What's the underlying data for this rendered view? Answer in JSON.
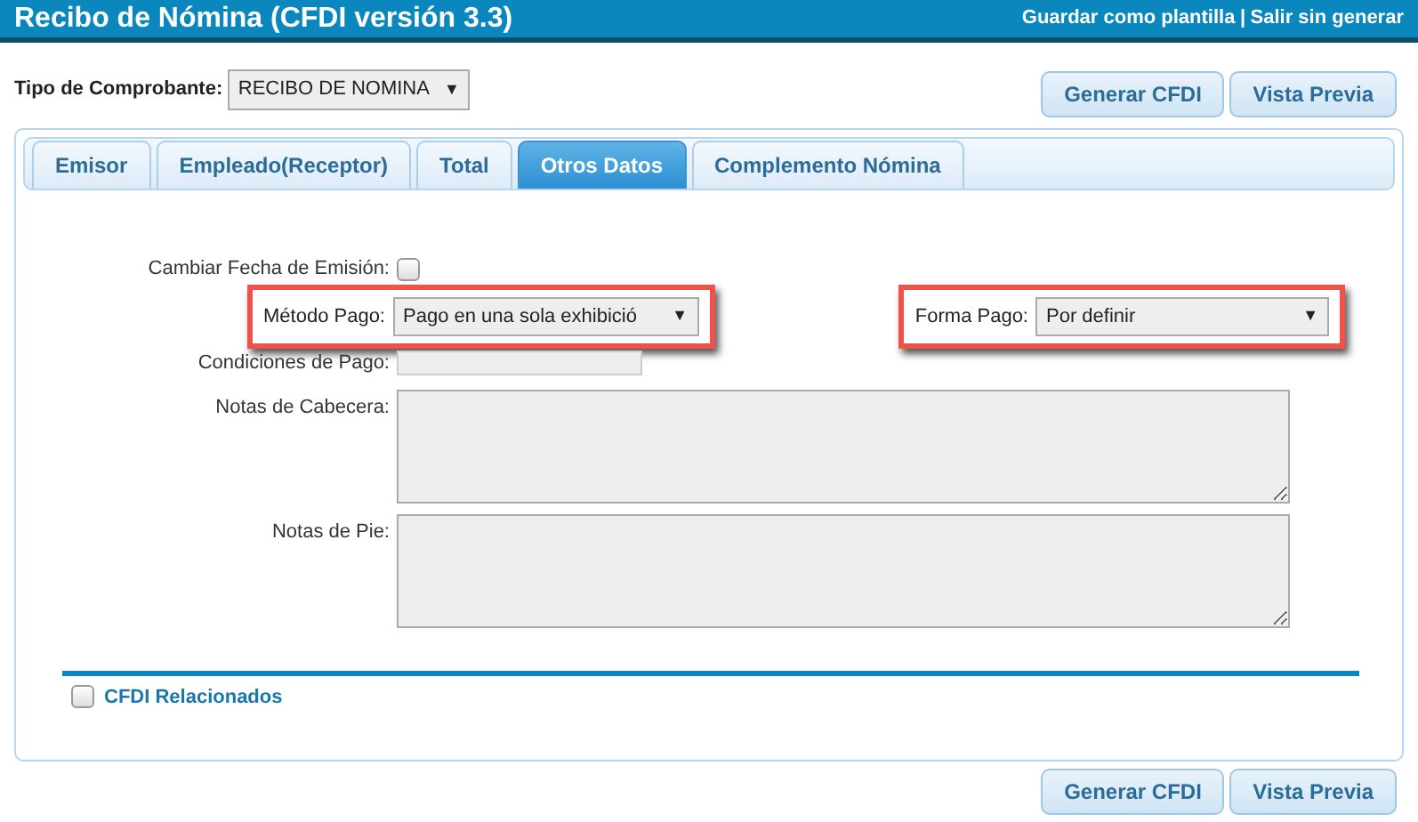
{
  "window": {
    "title": "Recibo de Nómina (CFDI versión 3.3)",
    "links": [
      "Guardar como plantilla",
      "Salir sin generar"
    ],
    "link_separator": "|"
  },
  "tipo_comprobante": {
    "label": "Tipo de Comprobante:",
    "value": "RECIBO DE NOMINA",
    "arrow": "▼"
  },
  "top_buttons": [
    "Generar CFDI",
    "Vista Previa"
  ],
  "tabs": [
    {
      "label": "Emisor",
      "selected": false
    },
    {
      "label": "Empleado(Receptor)",
      "selected": false
    },
    {
      "label": "Total",
      "selected": false
    },
    {
      "label": "Otros Datos",
      "selected": true
    },
    {
      "label": "Complemento Nómina",
      "selected": false
    }
  ],
  "form": {
    "cambiar_fecha": {
      "label": "Cambiar Fecha de Emisión:",
      "checked": false
    },
    "metodo_pago": {
      "label": "Método Pago:",
      "value": "Pago en una sola exhibició",
      "arrow": "▼",
      "highlighted": true
    },
    "forma_pago": {
      "label": "Forma Pago:",
      "value": "Por definir",
      "arrow": "▼",
      "highlighted": true
    },
    "condiciones_pago": {
      "label": "Condiciones de Pago:"
    },
    "notas_cabecera": {
      "label": "Notas de Cabecera:"
    },
    "notas_pie": {
      "label": "Notas de Pie:"
    }
  },
  "cfdi_relacionados": {
    "label": "CFDI Relacionados",
    "checked": false
  },
  "bottom_buttons": [
    "Generar CFDI",
    "Vista Previa"
  ]
}
